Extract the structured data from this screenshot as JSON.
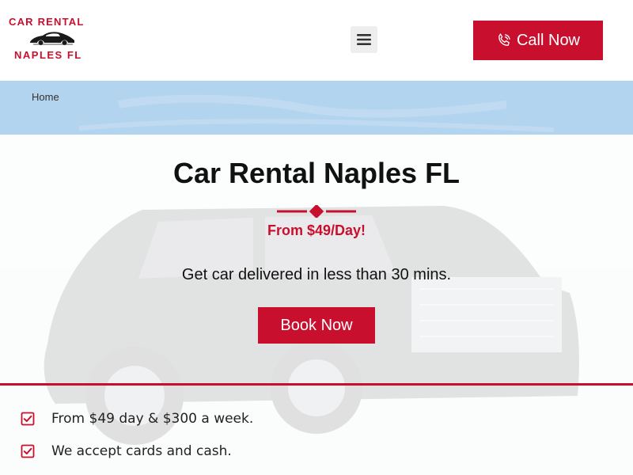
{
  "header": {
    "logo": {
      "line1": "CAR RENTAL",
      "line2": "NAPLES FL",
      "icon": "car-silhouette-icon"
    },
    "menu_icon": "hamburger-menu-icon",
    "call_button": {
      "label": "Call Now",
      "icon": "phone-icon"
    }
  },
  "breadcrumb": {
    "home": "Home"
  },
  "hero": {
    "title": "Car Rental Naples FL",
    "price": "From $49/Day!",
    "subtitle": "Get car delivered in less than 30 mins.",
    "book_button": "Book Now"
  },
  "features": [
    {
      "icon": "checkbox-checked-icon",
      "text": "From $49 day & $300 a week."
    },
    {
      "icon": "checkbox-checked-icon",
      "text": "We accept cards and cash."
    }
  ],
  "colors": {
    "brand_red": "#c8102e",
    "breadcrumb_band": "#b3d4ee",
    "text_dark": "#111111",
    "menu_button_bg": "#eeeeee"
  }
}
